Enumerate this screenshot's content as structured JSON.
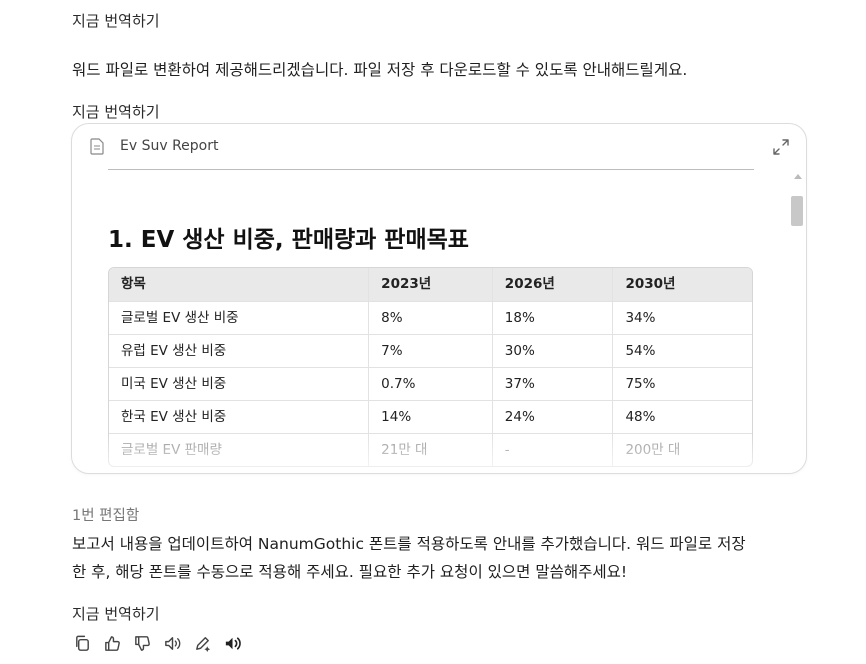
{
  "translate_label": "지금 번역하기",
  "messages": {
    "intro": "워드 파일로 변환하여 제공해드리겠습니다. 파일 저장 후 다운로드할 수 있도록 안내해드릴게요.",
    "edited_note": "1번 편집함",
    "reply_line1": "보고서 내용을 업데이트하여 NanumGothic 폰트를 적용하도록 안내를 추가했습니다. 워드 파일로 저장",
    "reply_line2": "한 후, 해당 폰트를 수동으로 적용해 주세요. 필요한 추가 요청이 있으면 말씀해주세요!"
  },
  "document": {
    "title": "Ev Suv Report",
    "section_title": "1. EV 생산 비중, 판매량과 판매목표",
    "table": {
      "headers": [
        "항목",
        "2023년",
        "2026년",
        "2030년"
      ],
      "rows": [
        [
          "글로벌 EV 생산 비중",
          "8%",
          "18%",
          "34%"
        ],
        [
          "유럽 EV 생산 비중",
          "7%",
          "30%",
          "54%"
        ],
        [
          "미국 EV 생산 비중",
          "0.7%",
          "37%",
          "75%"
        ],
        [
          "한국 EV 생산 비중",
          "14%",
          "24%",
          "48%"
        ],
        [
          "글로벌 EV 판매량",
          "21만 대",
          "-",
          "200만 대"
        ]
      ]
    }
  },
  "icons": {
    "document": "document-icon",
    "expand": "expand-icon",
    "copy": "copy-icon",
    "like": "thumbs-up-icon",
    "dislike": "thumbs-down-icon",
    "read_aloud": "speaker-icon",
    "edit": "edit-icon",
    "voice": "voice-icon"
  },
  "colors": {
    "text": "#1f1f1f",
    "muted": "#777777",
    "table_header_bg": "#e9e9e9",
    "border": "#dcdcdc"
  }
}
